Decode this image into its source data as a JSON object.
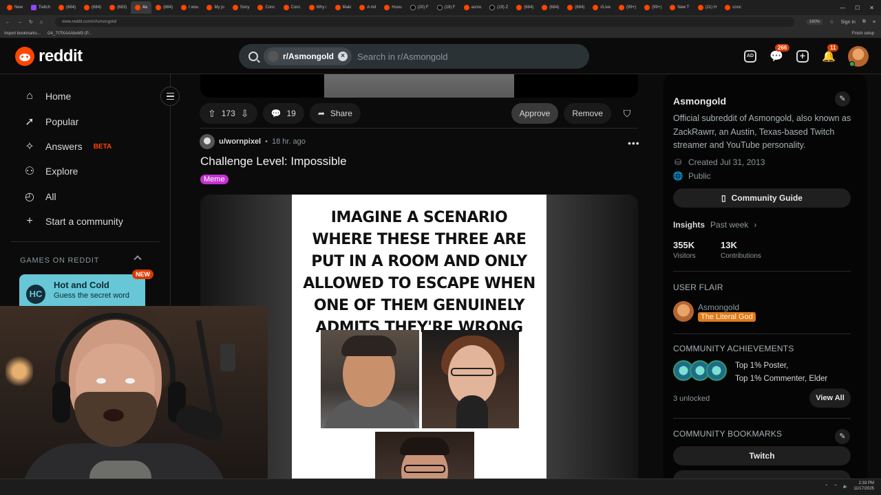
{
  "browser": {
    "tabs": [
      "New",
      "Twitch",
      "(684)",
      "(684)",
      "(683)",
      "As",
      "(684)",
      "I wou",
      "My jo",
      "Sony",
      "Conc",
      "Conc",
      "Why i",
      "Maki",
      "A mil",
      "Huou",
      "(20) F",
      "(19) F",
      "asmo",
      "(19) Z",
      "(684)",
      "(684)",
      "(684)",
      "r/Live",
      "(99+)",
      "(99+)",
      "New T",
      "(21) H",
      "conc"
    ],
    "url": "www.reddit.com/r/Asmongold/",
    "zoom": "160%",
    "sign_in": "Sign in",
    "bookmarks": [
      "Import bookmarks...",
      "G4_7t7fXAAAbvM3 (P..."
    ],
    "finish_setup": "Finish setup"
  },
  "header": {
    "logo_text": "reddit",
    "search_chip": "r/Asmongold",
    "search_placeholder": "Search in r/Asmongold",
    "chat_badge": "266",
    "notif_badge": "11",
    "ad_icon_text": "AD"
  },
  "nav": {
    "items": [
      {
        "label": "Home",
        "icon": "home-icon"
      },
      {
        "label": "Popular",
        "icon": "popular-icon"
      },
      {
        "label": "Answers",
        "icon": "answers-icon",
        "tag": "BETA"
      },
      {
        "label": "Explore",
        "icon": "explore-icon"
      },
      {
        "label": "All",
        "icon": "all-icon"
      },
      {
        "label": "Start a community",
        "icon": "plus-icon"
      }
    ],
    "games_title": "GAMES ON REDDIT",
    "game": {
      "title": "Hot and Cold",
      "subtitle": "Guess the secret word",
      "badge": "NEW"
    }
  },
  "prev_post": {
    "votes": "173",
    "comments": "19",
    "share_label": "Share",
    "approve_label": "Approve",
    "remove_label": "Remove"
  },
  "post": {
    "author": "u/wornpixel",
    "time": "18 hr. ago",
    "title": "Challenge Level: Impossible",
    "flair": "Meme",
    "meme_text": "IMAGINE A SCENARIO WHERE THESE THREE ARE PUT IN A ROOM AND ONLY ALLOWED TO ESCAPE WHEN ONE OF THEM GENUINELY ADMITS THEY'RE WRONG"
  },
  "sidebar": {
    "name": "Asmongold",
    "description": "Official subreddit of Asmongold, also known as ZackRawrr, an Austin, Texas-based Twitch streamer and YouTube personality.",
    "created": "Created Jul 31, 2013",
    "visibility": "Public",
    "guide_label": "Community Guide",
    "insights_label": "Insights",
    "insights_period": "Past week",
    "visitors_value": "355K",
    "visitors_label": "Visitors",
    "contrib_value": "13K",
    "contrib_label": "Contributions",
    "user_flair_title": "USER FLAIR",
    "flair_user": "Asmongold",
    "flair_tag": "The Literal God",
    "achievements_title": "COMMUNITY ACHIEVEMENTS",
    "achievements_line1": "Top 1% Poster,",
    "achievements_line2": "Top 1% Commenter, Elder",
    "unlocked": "3 unlocked",
    "view_all": "View All",
    "bookmarks_title": "COMMUNITY BOOKMARKS",
    "bookmark_1": "Twitch"
  },
  "taskbar": {
    "time": "2:33 PM",
    "date": "11/17/2025"
  }
}
